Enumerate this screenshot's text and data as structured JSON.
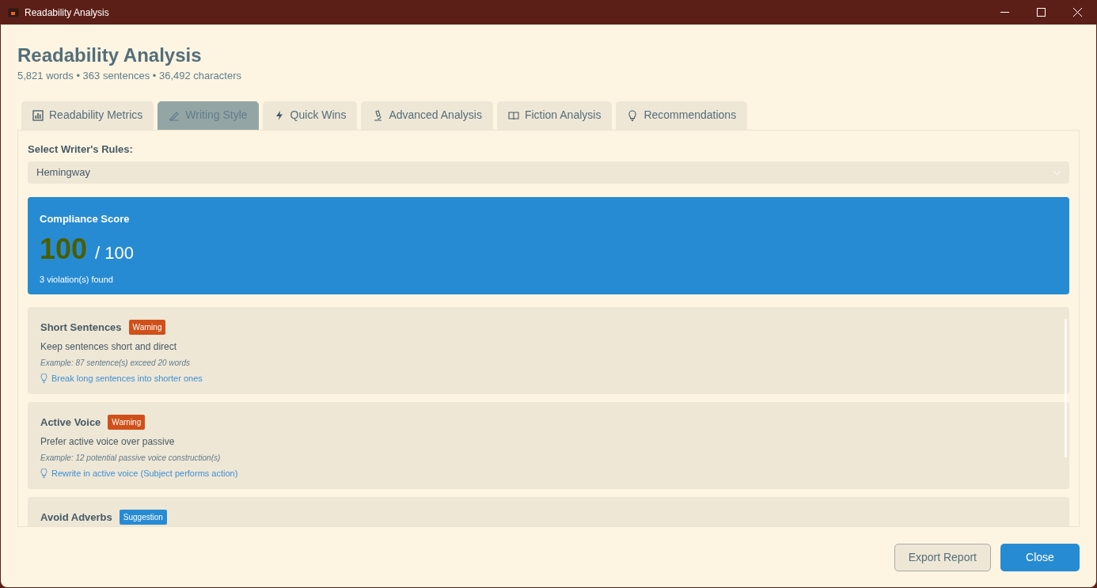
{
  "window": {
    "title": "Readability Analysis"
  },
  "header": {
    "title": "Readability Analysis",
    "stats": "5,821 words • 363 sentences • 36,492 characters"
  },
  "tabs": [
    {
      "label": "Readability Metrics",
      "kind": "chart",
      "selected": false
    },
    {
      "label": "Writing Style",
      "kind": "pen",
      "selected": true
    },
    {
      "label": "Quick Wins",
      "kind": "bolt",
      "selected": false
    },
    {
      "label": "Advanced Analysis",
      "kind": "microscope",
      "selected": false
    },
    {
      "label": "Fiction Analysis",
      "kind": "book",
      "selected": false
    },
    {
      "label": "Recommendations",
      "kind": "bulb",
      "selected": false
    }
  ],
  "rules_select": {
    "label": "Select Writer's Rules:",
    "value": "Hemingway"
  },
  "compliance": {
    "title": "Compliance Score",
    "score": "100",
    "max": "/ 100",
    "summary": "3 violation(s) found"
  },
  "rules": [
    {
      "title": "Short Sentences",
      "severity": "Warning",
      "kind": "warning",
      "description": "Keep sentences short and direct",
      "example": "Example: 87 sentence(s) exceed 20 words",
      "tip": "Break long sentences into shorter ones"
    },
    {
      "title": "Active Voice",
      "severity": "Warning",
      "kind": "warning",
      "description": "Prefer active voice over passive",
      "example": "Example: 12 potential passive voice construction(s)",
      "tip": "Rewrite in active voice (Subject performs action)"
    },
    {
      "title": "Avoid Adverbs",
      "severity": "Suggestion",
      "kind": "suggestion"
    }
  ],
  "buttons": [
    {
      "label": "Export Report",
      "kind": "secondary"
    },
    {
      "label": "Close",
      "kind": "primary"
    }
  ]
}
